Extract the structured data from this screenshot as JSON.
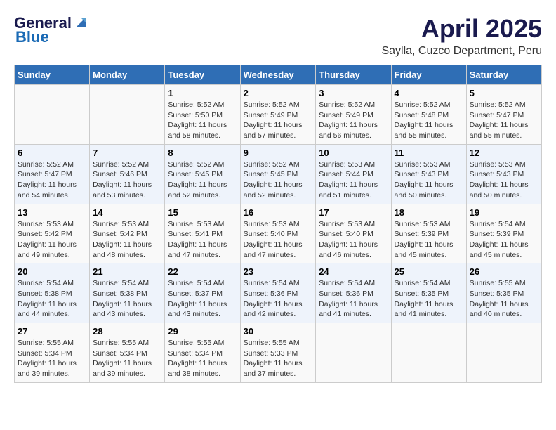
{
  "logo": {
    "general": "General",
    "blue": "Blue"
  },
  "title": "April 2025",
  "subtitle": "Saylla, Cuzco Department, Peru",
  "headers": [
    "Sunday",
    "Monday",
    "Tuesday",
    "Wednesday",
    "Thursday",
    "Friday",
    "Saturday"
  ],
  "weeks": [
    [
      {
        "day": "",
        "info": ""
      },
      {
        "day": "",
        "info": ""
      },
      {
        "day": "1",
        "info": "Sunrise: 5:52 AM\nSunset: 5:50 PM\nDaylight: 11 hours and 58 minutes."
      },
      {
        "day": "2",
        "info": "Sunrise: 5:52 AM\nSunset: 5:49 PM\nDaylight: 11 hours and 57 minutes."
      },
      {
        "day": "3",
        "info": "Sunrise: 5:52 AM\nSunset: 5:49 PM\nDaylight: 11 hours and 56 minutes."
      },
      {
        "day": "4",
        "info": "Sunrise: 5:52 AM\nSunset: 5:48 PM\nDaylight: 11 hours and 55 minutes."
      },
      {
        "day": "5",
        "info": "Sunrise: 5:52 AM\nSunset: 5:47 PM\nDaylight: 11 hours and 55 minutes."
      }
    ],
    [
      {
        "day": "6",
        "info": "Sunrise: 5:52 AM\nSunset: 5:47 PM\nDaylight: 11 hours and 54 minutes."
      },
      {
        "day": "7",
        "info": "Sunrise: 5:52 AM\nSunset: 5:46 PM\nDaylight: 11 hours and 53 minutes."
      },
      {
        "day": "8",
        "info": "Sunrise: 5:52 AM\nSunset: 5:45 PM\nDaylight: 11 hours and 52 minutes."
      },
      {
        "day": "9",
        "info": "Sunrise: 5:52 AM\nSunset: 5:45 PM\nDaylight: 11 hours and 52 minutes."
      },
      {
        "day": "10",
        "info": "Sunrise: 5:53 AM\nSunset: 5:44 PM\nDaylight: 11 hours and 51 minutes."
      },
      {
        "day": "11",
        "info": "Sunrise: 5:53 AM\nSunset: 5:43 PM\nDaylight: 11 hours and 50 minutes."
      },
      {
        "day": "12",
        "info": "Sunrise: 5:53 AM\nSunset: 5:43 PM\nDaylight: 11 hours and 50 minutes."
      }
    ],
    [
      {
        "day": "13",
        "info": "Sunrise: 5:53 AM\nSunset: 5:42 PM\nDaylight: 11 hours and 49 minutes."
      },
      {
        "day": "14",
        "info": "Sunrise: 5:53 AM\nSunset: 5:42 PM\nDaylight: 11 hours and 48 minutes."
      },
      {
        "day": "15",
        "info": "Sunrise: 5:53 AM\nSunset: 5:41 PM\nDaylight: 11 hours and 47 minutes."
      },
      {
        "day": "16",
        "info": "Sunrise: 5:53 AM\nSunset: 5:40 PM\nDaylight: 11 hours and 47 minutes."
      },
      {
        "day": "17",
        "info": "Sunrise: 5:53 AM\nSunset: 5:40 PM\nDaylight: 11 hours and 46 minutes."
      },
      {
        "day": "18",
        "info": "Sunrise: 5:53 AM\nSunset: 5:39 PM\nDaylight: 11 hours and 45 minutes."
      },
      {
        "day": "19",
        "info": "Sunrise: 5:54 AM\nSunset: 5:39 PM\nDaylight: 11 hours and 45 minutes."
      }
    ],
    [
      {
        "day": "20",
        "info": "Sunrise: 5:54 AM\nSunset: 5:38 PM\nDaylight: 11 hours and 44 minutes."
      },
      {
        "day": "21",
        "info": "Sunrise: 5:54 AM\nSunset: 5:38 PM\nDaylight: 11 hours and 43 minutes."
      },
      {
        "day": "22",
        "info": "Sunrise: 5:54 AM\nSunset: 5:37 PM\nDaylight: 11 hours and 43 minutes."
      },
      {
        "day": "23",
        "info": "Sunrise: 5:54 AM\nSunset: 5:36 PM\nDaylight: 11 hours and 42 minutes."
      },
      {
        "day": "24",
        "info": "Sunrise: 5:54 AM\nSunset: 5:36 PM\nDaylight: 11 hours and 41 minutes."
      },
      {
        "day": "25",
        "info": "Sunrise: 5:54 AM\nSunset: 5:35 PM\nDaylight: 11 hours and 41 minutes."
      },
      {
        "day": "26",
        "info": "Sunrise: 5:55 AM\nSunset: 5:35 PM\nDaylight: 11 hours and 40 minutes."
      }
    ],
    [
      {
        "day": "27",
        "info": "Sunrise: 5:55 AM\nSunset: 5:34 PM\nDaylight: 11 hours and 39 minutes."
      },
      {
        "day": "28",
        "info": "Sunrise: 5:55 AM\nSunset: 5:34 PM\nDaylight: 11 hours and 39 minutes."
      },
      {
        "day": "29",
        "info": "Sunrise: 5:55 AM\nSunset: 5:34 PM\nDaylight: 11 hours and 38 minutes."
      },
      {
        "day": "30",
        "info": "Sunrise: 5:55 AM\nSunset: 5:33 PM\nDaylight: 11 hours and 37 minutes."
      },
      {
        "day": "",
        "info": ""
      },
      {
        "day": "",
        "info": ""
      },
      {
        "day": "",
        "info": ""
      }
    ]
  ]
}
